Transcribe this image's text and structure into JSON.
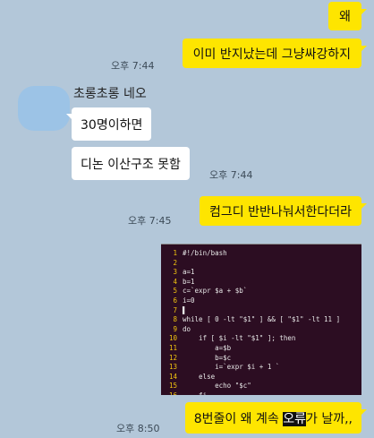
{
  "messages": {
    "m1_text": "왜",
    "m2_text": "이미 반지났는데 그냥싸강하지",
    "m2_time": "오후 7:44",
    "sender_name": "초롱초롱 네오",
    "m3_text": "30명이하면",
    "m4_text": "디논 이산구조 못함",
    "m4_time": "오후 7:44",
    "m5_text": "컴그디 반반나눠서한다더라",
    "m5_time": "오후 7:45",
    "m6_before": "8번줄이 왜 계속 ",
    "m6_highlight": "오류",
    "m6_after": "가 날까,,",
    "m6_time": "오후 8:50"
  },
  "code": [
    {
      "n": "1",
      "t": "#!/bin/bash"
    },
    {
      "n": "2",
      "t": ""
    },
    {
      "n": "3",
      "t": "a=1"
    },
    {
      "n": "4",
      "t": "b=1"
    },
    {
      "n": "5",
      "t": "c=`expr $a + $b`"
    },
    {
      "n": "6",
      "t": "i=0"
    },
    {
      "n": "7",
      "t": "▌"
    },
    {
      "n": "8",
      "t": "while [ 0 -lt \"$1\" ] && [ \"$1\" -lt 11 ]"
    },
    {
      "n": "9",
      "t": "do"
    },
    {
      "n": "10",
      "t": "    if [ $i -lt \"$1\" ]; then"
    },
    {
      "n": "11",
      "t": "        a=$b"
    },
    {
      "n": "12",
      "t": "        b=$c"
    },
    {
      "n": "13",
      "t": "        i=`expr $i + 1 `"
    },
    {
      "n": "14",
      "t": "    else"
    },
    {
      "n": "15",
      "t": "        echo \"$c\""
    },
    {
      "n": "16",
      "t": "    fi"
    },
    {
      "n": "17",
      "t": "done"
    }
  ],
  "colors": {
    "background": "#b3c7d9",
    "my_bubble": "#fee500",
    "their_bubble": "#ffffff",
    "terminal_bg": "#2c0d22",
    "line_number": "#f1c40f"
  }
}
